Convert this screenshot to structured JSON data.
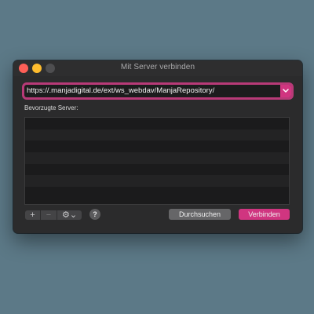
{
  "window": {
    "title": "Mit Server verbinden"
  },
  "server_address": {
    "value": "https://.manjadigital.de/ext/ws_webdav/ManjaRepository/"
  },
  "favorites": {
    "label": "Bevorzugte Server:",
    "items": []
  },
  "toolbar": {
    "add_label": "+",
    "remove_label": "−",
    "action_label": "⚙⌄",
    "help_label": "?"
  },
  "buttons": {
    "browse_label": "Durchsuchen",
    "connect_label": "Verbinden"
  },
  "colors": {
    "accent": "#d03580",
    "focus_ring": "#b83a78"
  },
  "icons": {
    "dropdown": "chevron-down-icon",
    "settings": "gear-icon"
  }
}
